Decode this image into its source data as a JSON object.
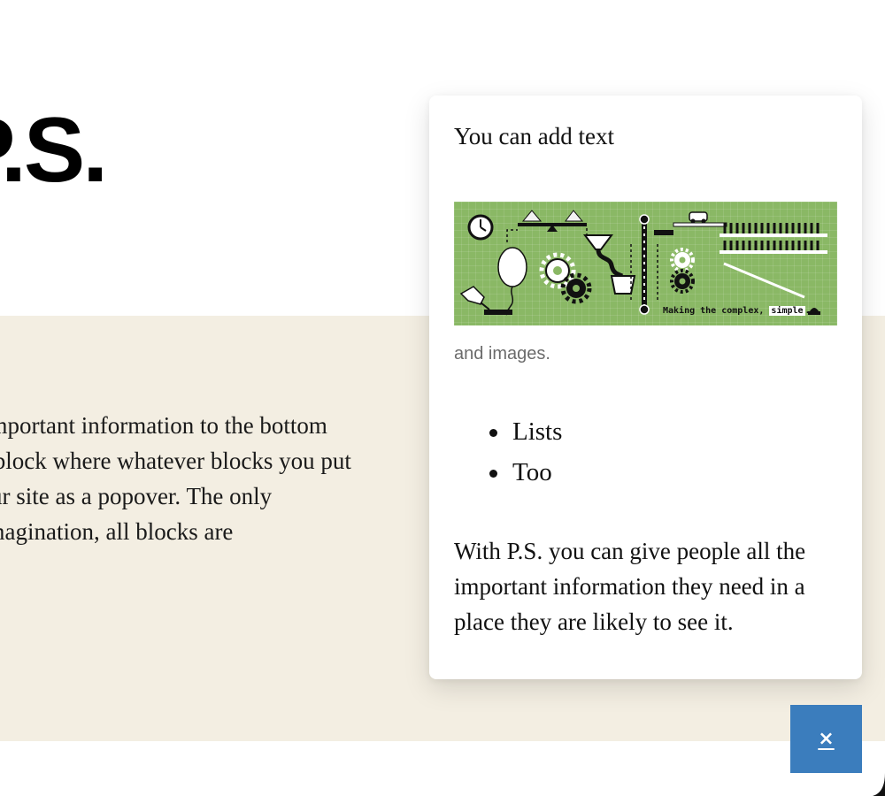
{
  "page": {
    "hero_title": "P.S.",
    "body_lines": [
      "o bring important information to the bottom",
      "Popover block where whatever blocks you put",
      "ed on your site as a popover. The only",
      "is your imagination, all blocks are"
    ]
  },
  "popover": {
    "heading": "You can add text",
    "banner": {
      "image_name": "Making the complex simple illustration",
      "caption_prefix": "Making the complex, ",
      "caption_highlight": "simple",
      "caption_suffix": ".",
      "background_color": "#8ab865"
    },
    "caption": "and images.",
    "list_items": [
      "Lists",
      "Too"
    ],
    "paragraph": "With P.S. you can give people all the important information they need in a place they are likely to see it."
  },
  "close_button": {
    "label": "×",
    "color": "#3b7dbd"
  },
  "colors": {
    "band_background": "#f3eee2",
    "text": "#111111"
  }
}
